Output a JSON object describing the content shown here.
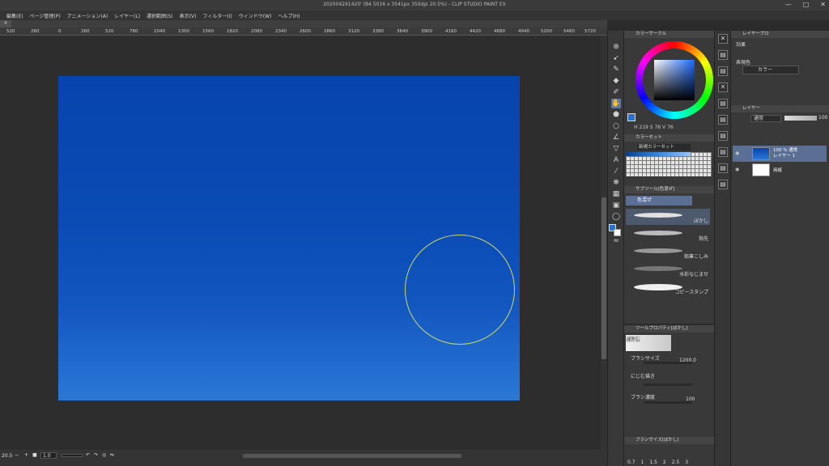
{
  "window": {
    "title": "20200429142​0' (B4 5016 x 3541px 350dpi 20.5%)  -  CLIP STUDIO PAINT EX",
    "min": "—",
    "max": "□",
    "close": "✕"
  },
  "menu": [
    "編集(E)",
    "ページ管理(P)",
    "アニメーション(A)",
    "レイヤー(L)",
    "選択範囲(S)",
    "表示(V)",
    "フィルター(I)",
    "ウィンドウ(W)",
    "ヘルプ(H)"
  ],
  "tab": {
    "close": "×"
  },
  "ruler_ticks": [
    "520",
    "260",
    "0",
    "260",
    "520",
    "780",
    "1040",
    "1300",
    "1560",
    "1820",
    "2080",
    "2340",
    "2600",
    "2860",
    "3120",
    "3380",
    "3640",
    "3900",
    "4160",
    "4420",
    "4680",
    "4940",
    "5200",
    "5460",
    "5720"
  ],
  "status": {
    "zoom": "20.5",
    "angle": "1.0",
    "minus": "−",
    "plus": "+"
  },
  "colors": {
    "main": "#2a70d0",
    "sub": "#ffffff",
    "canvas_top": "#0844ad",
    "canvas_bottom": "#2a78d6",
    "cursor": "#c9d96a"
  },
  "color_wheel": {
    "header": "カラーサークル",
    "h": "219",
    "s": "76",
    "v": "76"
  },
  "color_set": {
    "header": "カラーセット",
    "set_name": "新規カラーセット"
  },
  "subtool": {
    "header": "サブツール[色混ぜ]",
    "group": "色混ぜ",
    "brushes": [
      {
        "label": "ぼかし",
        "selected": true
      },
      {
        "label": "指先",
        "selected": false
      },
      {
        "label": "鉛筆こしみ",
        "selected": false
      },
      {
        "label": "水彩なじませ",
        "selected": false
      },
      {
        "label": "コピースタンプ",
        "selected": false
      }
    ]
  },
  "tool_property": {
    "header": "ツールプロパティ[ぼかし]",
    "name": "ぼかし",
    "brush_size_label": "ブラシサイズ",
    "brush_size_value": "1200.0",
    "blur_label": "にじむ描き",
    "density_label": "ブラシ濃度",
    "density_value": "100"
  },
  "brush_size_panel": {
    "header": "ブラシサイズ[ぼかし]",
    "sizes": [
      "0.7",
      "1",
      "1.5",
      "2",
      "2.5",
      "3"
    ]
  },
  "layer_property": {
    "header": "レイヤープロ",
    "effect_label": "効果",
    "display_color_label": "表現色",
    "display_color_value": "カラー"
  },
  "layer_panel": {
    "header": "レイヤー",
    "blend_mode": "通常",
    "opacity": "100",
    "layers": [
      {
        "line1": "100 % 通常",
        "line2": "レイヤー 1",
        "selected": true
      },
      {
        "line1": "",
        "line2": "用紙",
        "selected": false
      }
    ]
  }
}
